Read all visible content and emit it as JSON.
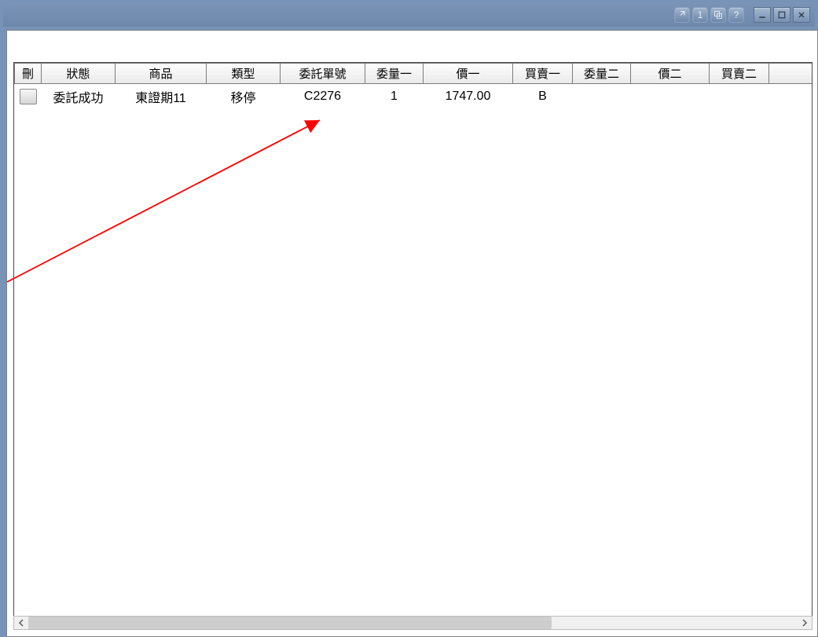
{
  "titlebar": {
    "btn_export": "↪",
    "btn_one": "1",
    "btn_add": "⧉",
    "btn_help": "?",
    "btn_min": "—",
    "btn_max": "□",
    "btn_close": "✕"
  },
  "table": {
    "headers": {
      "del": "刪",
      "status": "狀態",
      "product": "商品",
      "type": "類型",
      "order_no": "委託單號",
      "qty1": "委量一",
      "price1": "價一",
      "bs1": "買賣一",
      "qty2": "委量二",
      "price2": "價二",
      "bs2": "買賣二"
    },
    "rows": [
      {
        "status": "委託成功",
        "product": "東證期11",
        "type": "移停",
        "order_no": "C2276",
        "qty1": "1",
        "price1": "1747.00",
        "bs1": "B",
        "qty2": "",
        "price2": "",
        "bs2": ""
      }
    ]
  }
}
